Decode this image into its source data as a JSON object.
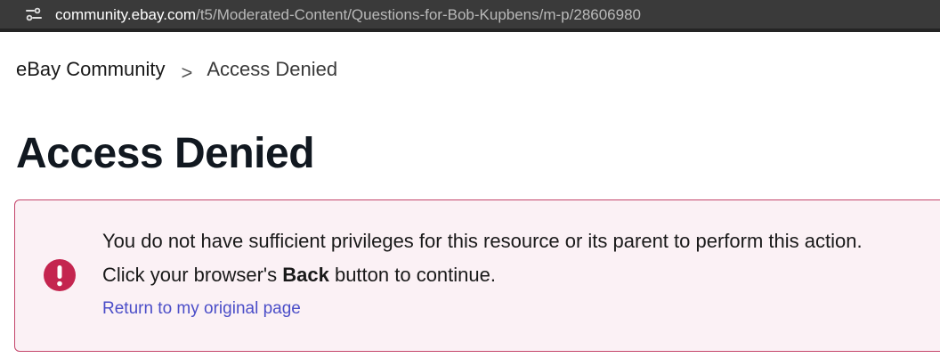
{
  "browser": {
    "url_host": "community.ebay.com",
    "url_path": "/t5/Moderated-Content/Questions-for-Bob-Kupbens/m-p/28606980",
    "site_info_icon": "tune-icon"
  },
  "breadcrumb": {
    "home": "eBay Community",
    "separator": ">",
    "current": "Access Denied"
  },
  "page": {
    "title": "Access Denied"
  },
  "alert": {
    "icon": "exclamation-icon",
    "color": "#c4254f",
    "message": "You do not have sufficient privileges for this resource or its parent to perform this action.",
    "instruction_prefix": "Click your browser's ",
    "instruction_bold": "Back",
    "instruction_suffix": " button to continue.",
    "link": "Return to my original page"
  }
}
